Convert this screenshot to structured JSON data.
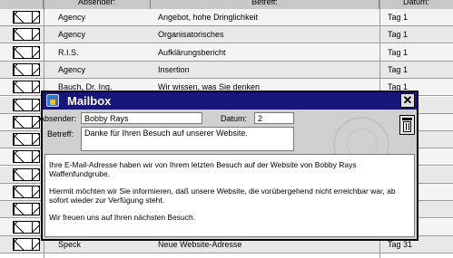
{
  "list": {
    "headers": {
      "from": "Absender:",
      "subject": "Betreff:",
      "date": "Datum:"
    },
    "rows": [
      {
        "from": "Agency",
        "subject": "Angebot, hohe Dringlichkeit",
        "date": "Tag 1"
      },
      {
        "from": "Agency",
        "subject": "Organisatorisches",
        "date": "Tag 1"
      },
      {
        "from": "R.I.S.",
        "subject": "Aufklärungsbericht",
        "date": "Tag 1"
      },
      {
        "from": "Agency",
        "subject": "Insertion",
        "date": "Tag 1"
      },
      {
        "from": "Bauch, Dr. Ing.",
        "subject": "Wir wissen, was Sie denken",
        "date": "Tag 1"
      },
      {
        "from": "",
        "subject": "",
        "date": ""
      },
      {
        "from": "",
        "subject": "",
        "date": ""
      },
      {
        "from": "",
        "subject": "",
        "date": ""
      },
      {
        "from": "",
        "subject": "",
        "date": ""
      },
      {
        "from": "",
        "subject": "",
        "date": ""
      },
      {
        "from": "",
        "subject": "",
        "date": ""
      },
      {
        "from": "",
        "subject": "",
        "date": ""
      },
      {
        "from": "",
        "subject": "",
        "date": ""
      },
      {
        "from": "Speck",
        "subject": "Neue Website-Adresse",
        "date": "Tag 31"
      }
    ]
  },
  "dialog": {
    "title": "Mailbox",
    "close_label": "✕",
    "sender_label": "Absender:",
    "sender_value": "Bobby Rays",
    "date_label": "Datum:",
    "date_value": "2",
    "subject_label": "Betreff:",
    "subject_value": "Danke für Ihren Besuch auf unserer Website.",
    "body": [
      "Ihre E-Mail-Adresse haben wir von Ihrem letzten Besuch auf der Website von Bobby Rays Waffenfundgrube.",
      "Hiermit möchten wir Sie informieren, daß unsere Website, die vorübergehend nicht erreichbar war, ab sofort wieder zur Verfügung steht.",
      "Wir freuen uns auf Ihren nächsten Besuch."
    ]
  },
  "icons": {
    "row_icon": "envelope-icon",
    "title_icon": "mailbox-icon",
    "trash": "trash-icon"
  },
  "colors": {
    "titlebar": "#17177a",
    "dialog_bg": "#d0d0d0"
  }
}
